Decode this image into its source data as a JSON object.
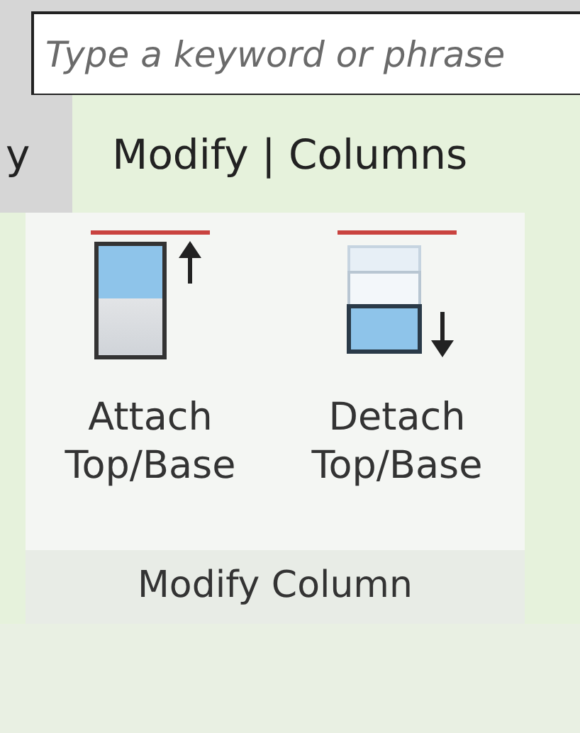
{
  "search": {
    "placeholder": "Type a keyword or phrase"
  },
  "tabs": [
    {
      "label": "y",
      "selected": false
    },
    {
      "label": "Modify | Columns",
      "selected": true
    }
  ],
  "panel": {
    "buttons": [
      {
        "label": "Attach Top/Base",
        "kind": "attach"
      },
      {
        "label": "Detach Top/Base",
        "kind": "detach"
      }
    ],
    "title": "Modify Column"
  }
}
